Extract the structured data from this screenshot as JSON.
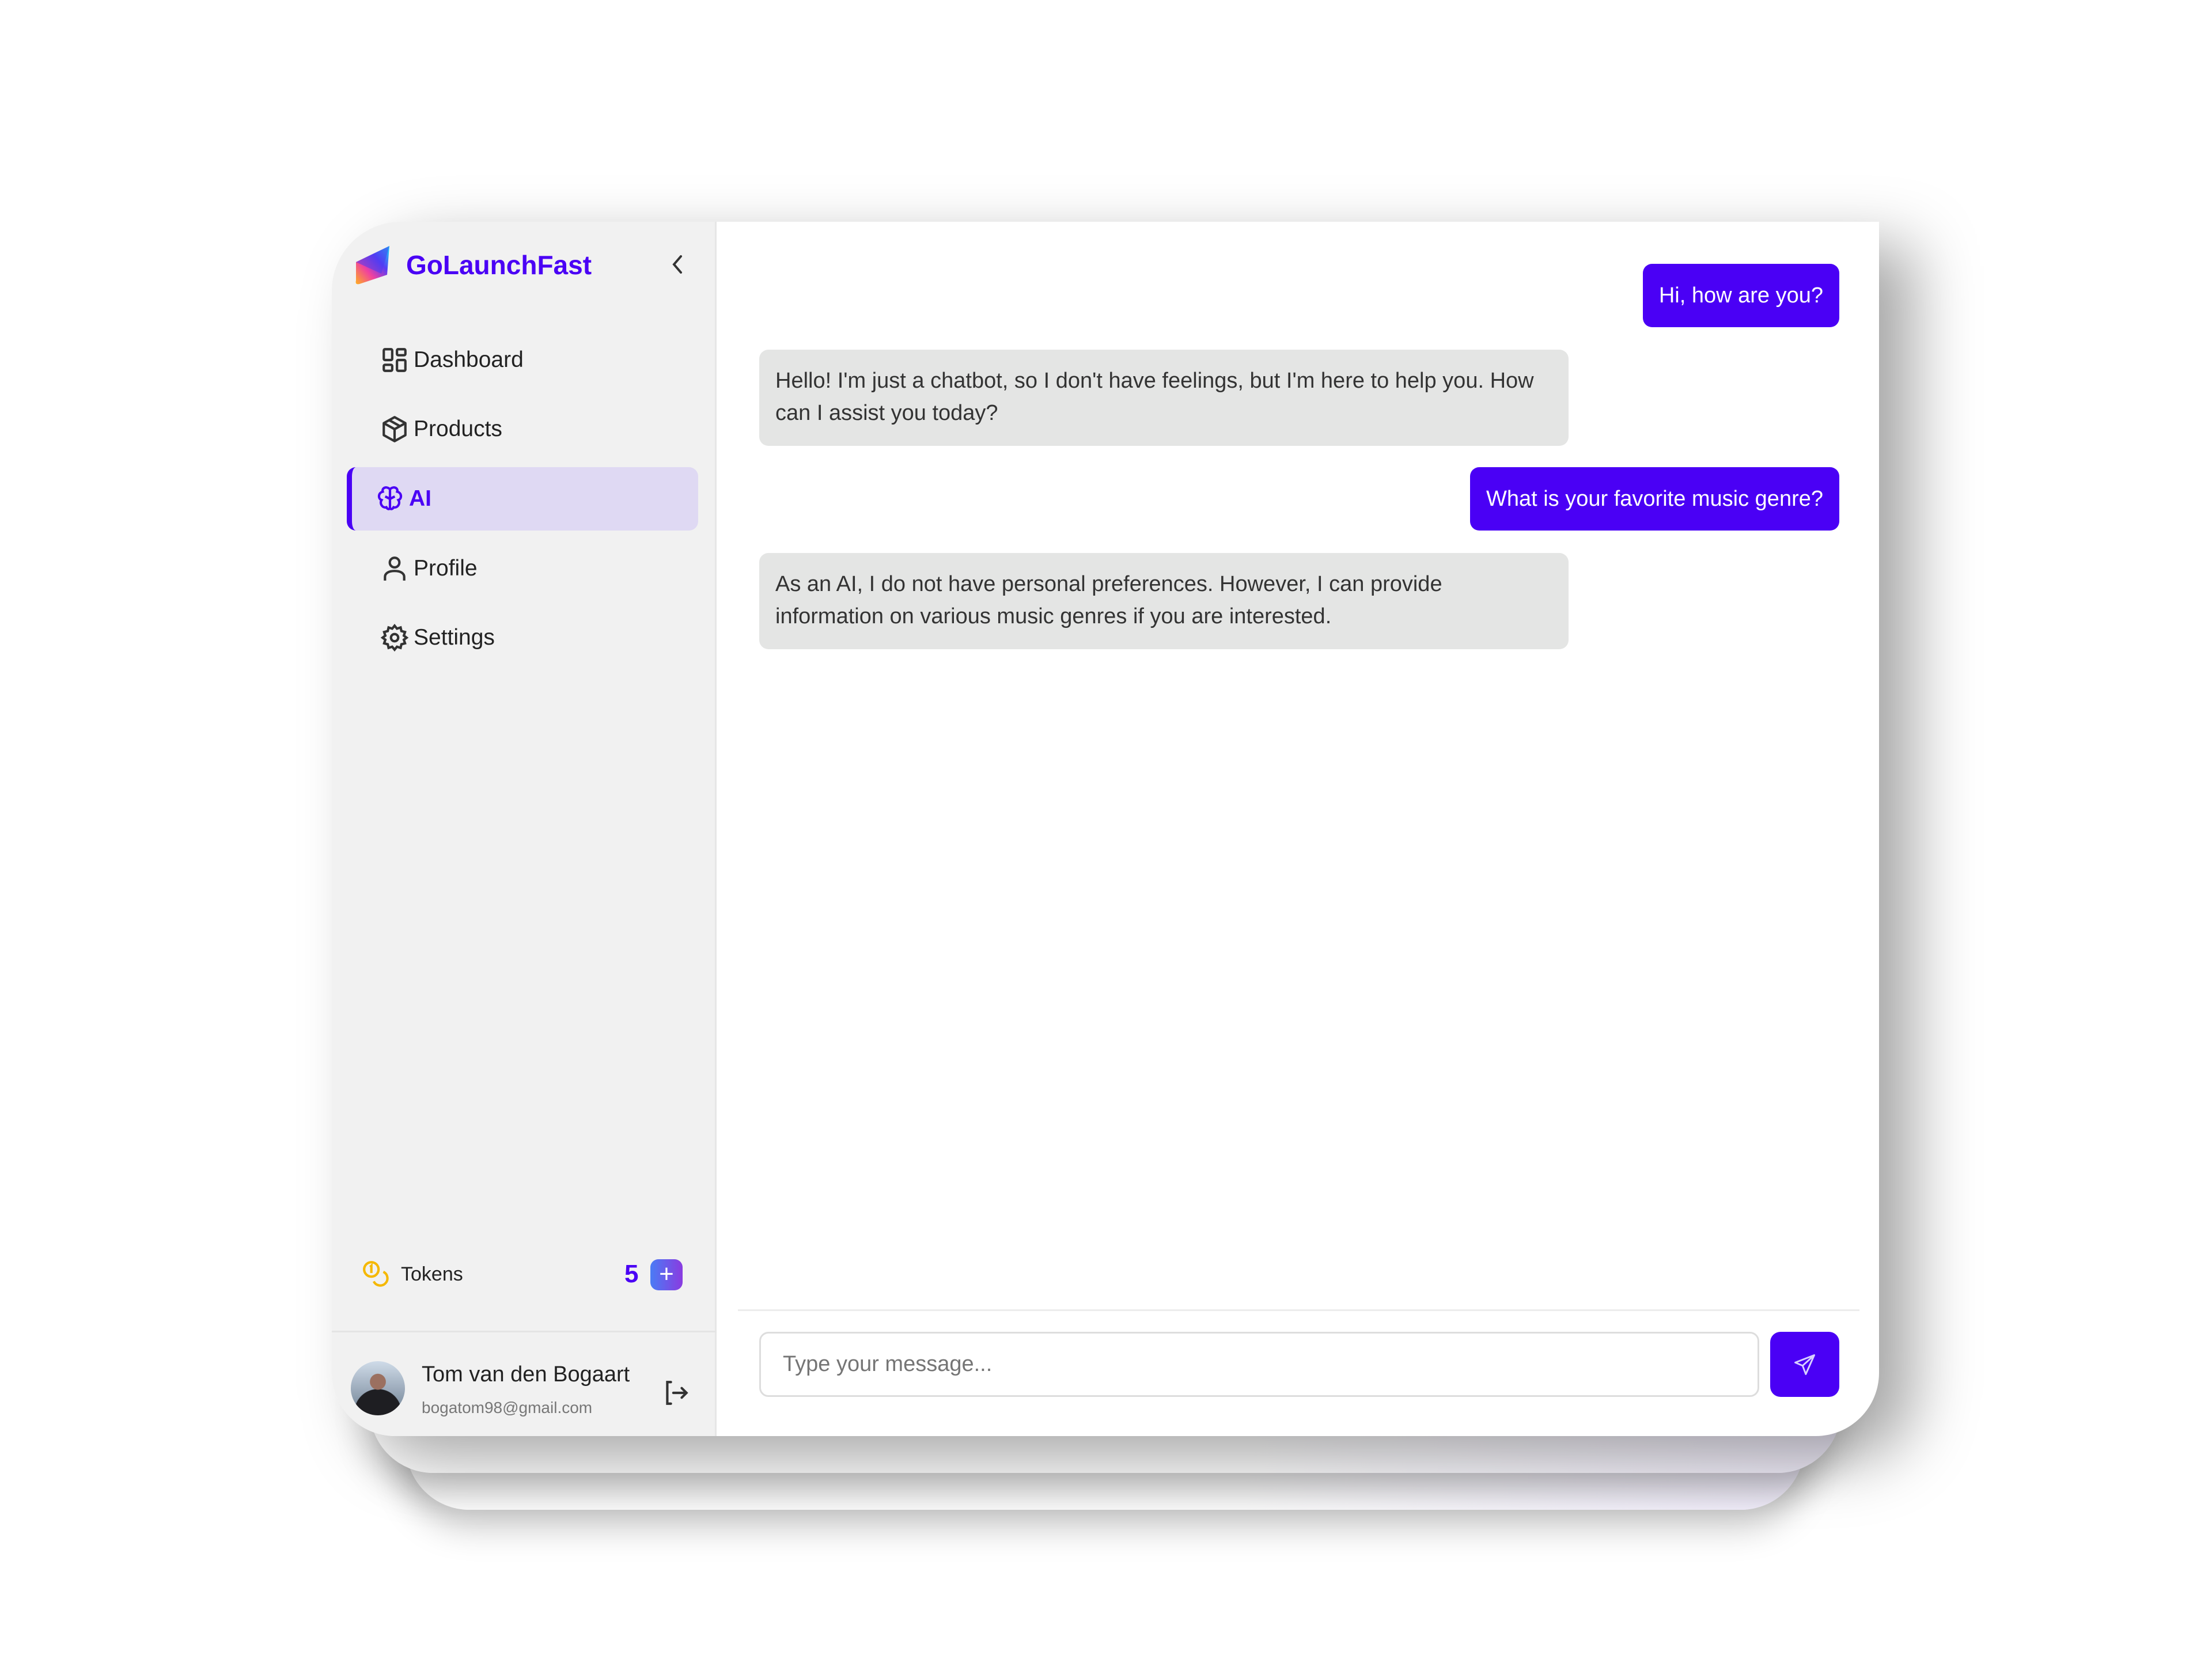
{
  "brand": {
    "name": "GoLaunchFast",
    "accent": "#4a00f5"
  },
  "sidebar": {
    "items": [
      {
        "label": "Dashboard",
        "icon": "dashboard-grid-icon",
        "active": false
      },
      {
        "label": "Products",
        "icon": "box-icon",
        "active": false
      },
      {
        "label": "AI",
        "icon": "brain-icon",
        "active": true
      },
      {
        "label": "Profile",
        "icon": "user-icon",
        "active": false
      },
      {
        "label": "Settings",
        "icon": "gear-icon",
        "active": false
      }
    ]
  },
  "tokens": {
    "label": "Tokens",
    "count": "5",
    "add_label": "+"
  },
  "user": {
    "name": "Tom van den Bogaart",
    "email": "bogatom98@gmail.com"
  },
  "chat": {
    "messages": [
      {
        "role": "user",
        "text": "Hi, how are you?"
      },
      {
        "role": "assistant",
        "text": "Hello! I'm just a chatbot, so I don't have feelings, but I'm here to help you. How can I assist you today?"
      },
      {
        "role": "user",
        "text": "What is your favorite music genre?"
      },
      {
        "role": "assistant",
        "text": "As an AI, I do not have personal preferences. However, I can provide information on various music genres if you are interested."
      }
    ],
    "input": {
      "value": "",
      "placeholder": "Type your message..."
    }
  }
}
